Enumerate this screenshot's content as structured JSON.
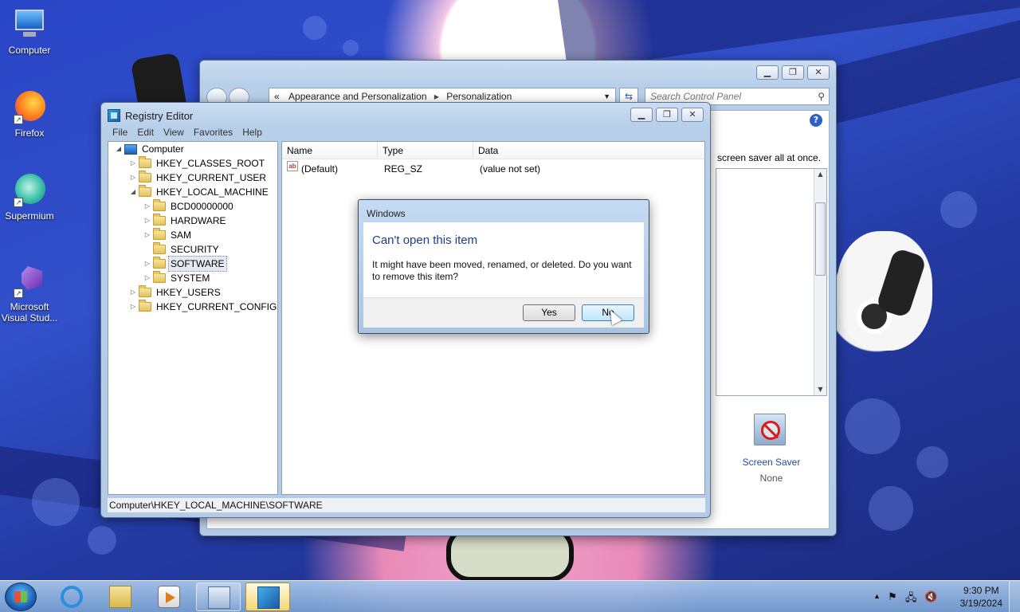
{
  "desktop": {
    "icons": [
      {
        "label": "Computer"
      },
      {
        "label": "Firefox"
      },
      {
        "label": "Supermium"
      },
      {
        "label": "Microsoft Visual Stud..."
      }
    ]
  },
  "control_panel": {
    "address_prefix": "«",
    "breadcrumb": [
      "Appearance and Personalization",
      "Personalization"
    ],
    "search_placeholder": "Search Control Panel",
    "partial_text": "screen saver all at once.",
    "screen_saver_title": "Screen Saver",
    "screen_saver_value": "None",
    "help_glyph": "?"
  },
  "registry_editor": {
    "title": "Registry Editor",
    "menu": [
      "File",
      "Edit",
      "View",
      "Favorites",
      "Help"
    ],
    "tree": {
      "root": "Computer",
      "hives": [
        "HKEY_CLASSES_ROOT",
        "HKEY_CURRENT_USER",
        "HKEY_LOCAL_MACHINE",
        "HKEY_USERS",
        "HKEY_CURRENT_CONFIG"
      ],
      "hklm_children": [
        "BCD00000000",
        "HARDWARE",
        "SAM",
        "SECURITY",
        "SOFTWARE",
        "SYSTEM"
      ],
      "selected": "SOFTWARE"
    },
    "columns": [
      "Name",
      "Type",
      "Data"
    ],
    "values": [
      {
        "name": "(Default)",
        "type": "REG_SZ",
        "data": "(value not set)",
        "icon_text": "ab"
      }
    ],
    "status": "Computer\\HKEY_LOCAL_MACHINE\\SOFTWARE"
  },
  "dialog": {
    "title": "Windows",
    "heading": "Can't open this item",
    "message": "It might have been moved, renamed, or deleted. Do you want to remove this item?",
    "yes": "Yes",
    "no": "No"
  },
  "taskbar": {
    "time": "9:30 PM",
    "date": "3/19/2024",
    "tray_glyphs": [
      "▲",
      "⚑",
      "🖧",
      "🔇"
    ]
  },
  "colors": {
    "dialog_heading": "#1e3c8c",
    "link": "#1f4e9c",
    "taskbar_active": "#f3d773"
  }
}
